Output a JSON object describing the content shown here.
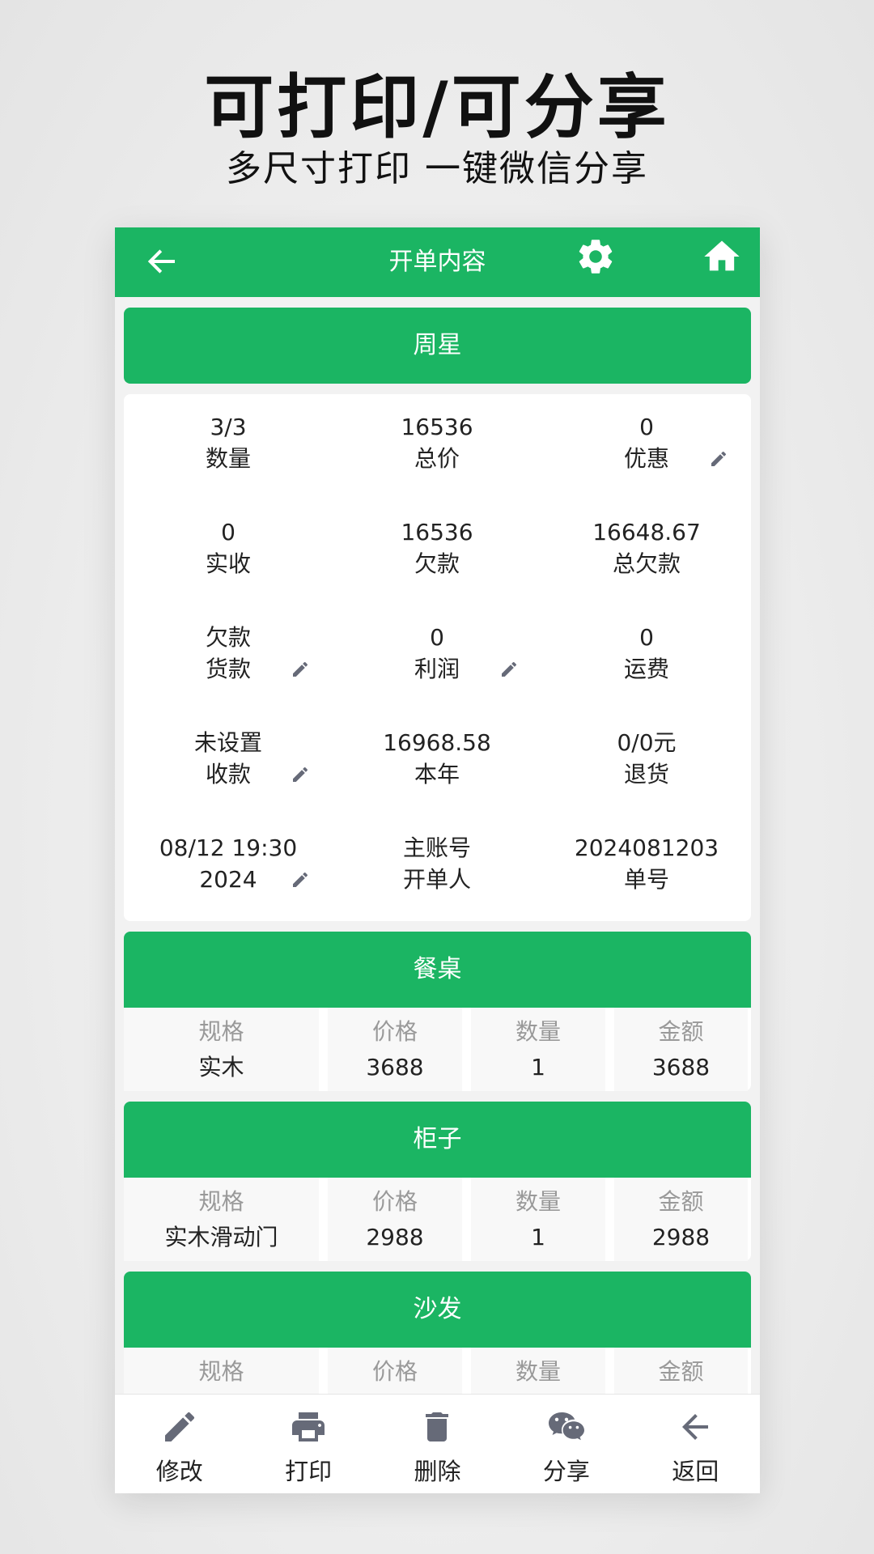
{
  "promo": {
    "title": "可打印/可分享",
    "subtitle": "多尺寸打印 一键微信分享"
  },
  "appbar": {
    "title": "开单内容",
    "back_icon": "arrow-left-icon",
    "settings_icon": "gear-icon",
    "home_icon": "home-icon"
  },
  "customer": {
    "name": "周星"
  },
  "stats": [
    {
      "value": "3/3",
      "label": "数量",
      "editable": false
    },
    {
      "value": "16536",
      "label": "总价",
      "editable": false
    },
    {
      "value": "0",
      "label": "优惠",
      "editable": true
    },
    {
      "value": "0",
      "label": "实收",
      "editable": false
    },
    {
      "value": "16536",
      "label": "欠款",
      "editable": false
    },
    {
      "value": "16648.67",
      "label": "总欠款",
      "editable": false
    },
    {
      "value": "欠款",
      "label": "货款",
      "editable": true
    },
    {
      "value": "0",
      "label": "利润",
      "editable": true
    },
    {
      "value": "0",
      "label": "运费",
      "editable": false
    },
    {
      "value": "未设置",
      "label": "收款",
      "editable": true
    },
    {
      "value": "16968.58",
      "label": "本年",
      "editable": false
    },
    {
      "value": "0/0元",
      "label": "退货",
      "editable": false
    },
    {
      "value": "08/12 19:30",
      "label": "2024",
      "editable": true
    },
    {
      "value": "主账号",
      "label": "开单人",
      "editable": false
    },
    {
      "value": "2024081203",
      "label": "单号",
      "editable": false
    }
  ],
  "table_headers": [
    "规格",
    "价格",
    "数量",
    "金额"
  ],
  "items": [
    {
      "name": "餐桌",
      "spec": "实木",
      "price": "3688",
      "qty": "1",
      "amount": "3688"
    },
    {
      "name": "柜子",
      "spec": "实木滑动门",
      "price": "2988",
      "qty": "1",
      "amount": "2988"
    },
    {
      "name": "沙发",
      "spec": "",
      "price": "",
      "qty": "",
      "amount": ""
    }
  ],
  "bottom_actions": [
    {
      "label": "修改",
      "icon": "pencil-icon"
    },
    {
      "label": "打印",
      "icon": "printer-icon"
    },
    {
      "label": "删除",
      "icon": "trash-icon"
    },
    {
      "label": "分享",
      "icon": "wechat-icon"
    },
    {
      "label": "返回",
      "icon": "arrow-left-icon"
    }
  ],
  "colors": {
    "accent": "#1bb563",
    "icon_gray": "#666a78",
    "header_text": "#999999"
  }
}
